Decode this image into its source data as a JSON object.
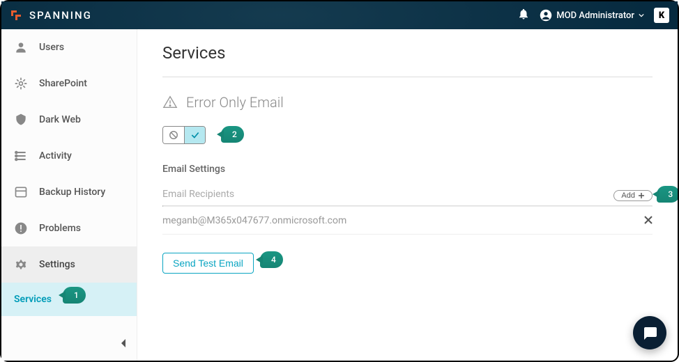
{
  "header": {
    "brand": "SPANNING",
    "user_label": "MOD Administrator"
  },
  "sidebar": {
    "items": [
      {
        "label": "Users"
      },
      {
        "label": "SharePoint"
      },
      {
        "label": "Dark Web"
      },
      {
        "label": "Activity"
      },
      {
        "label": "Backup History"
      },
      {
        "label": "Problems"
      },
      {
        "label": "Settings"
      },
      {
        "label": "Services"
      }
    ]
  },
  "main": {
    "page_title": "Services",
    "section_title": "Error Only Email",
    "email_settings_label": "Email Settings",
    "recipients_label": "Email Recipients",
    "add_label": "Add",
    "recipient_email": "meganb@M365x047677.onmicrosoft.com",
    "send_test_label": "Send Test Email"
  },
  "annotations": {
    "b1": "1",
    "b2": "2",
    "b3": "3",
    "b4": "4"
  }
}
